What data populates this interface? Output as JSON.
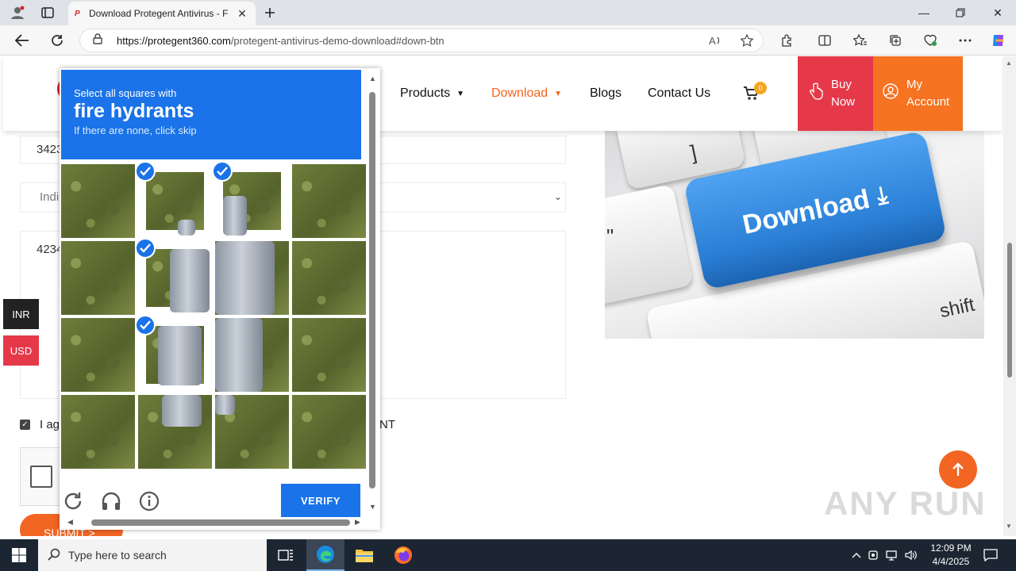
{
  "browser": {
    "tab_title": "Download Protegent Antivirus - F",
    "tab_favicon": "P",
    "url_host": "https://protegent360.com",
    "url_path": "/protegent-antivirus-demo-download#down-btn"
  },
  "site": {
    "nav": {
      "products": "Products",
      "download": "Download",
      "blogs": "Blogs",
      "contact": "Contact Us"
    },
    "cart_count": "0",
    "buy_now_line1": "Buy",
    "buy_now_line2": "Now",
    "account_line1": "My",
    "account_line2": "Account",
    "accent_color": "#f26522"
  },
  "form": {
    "field1_value": "3423",
    "field2_value": "Indi",
    "field3_value": "4234",
    "agree_left": "I ag",
    "agree_right": "NT",
    "submit_label": "SUBMIT >"
  },
  "promo": {
    "key_text": "Download",
    "shift_text": "shift",
    "bracket_text": "]",
    "quote_text": "\""
  },
  "currency": {
    "inr": "INR",
    "usd": "USD"
  },
  "captcha": {
    "prompt": "Select all squares with",
    "target": "fire hydrants",
    "hint": "If there are none, click skip",
    "verify_label": "VERIFY",
    "selected_tiles": [
      1,
      2,
      5,
      9
    ],
    "header_color": "#1a73e8"
  },
  "watermark": "ANY RUN",
  "taskbar": {
    "search_placeholder": "Type here to search",
    "time": "12:09 PM",
    "date": "4/4/2025"
  }
}
